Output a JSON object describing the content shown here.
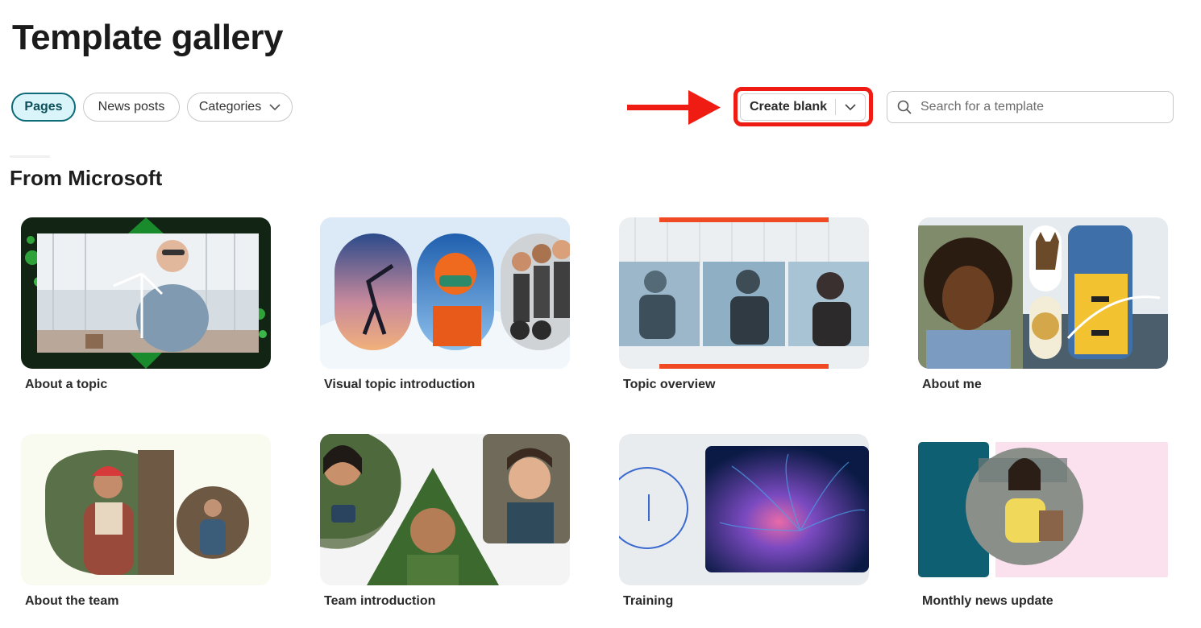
{
  "page": {
    "title": "Template gallery"
  },
  "filters": [
    {
      "label": "Pages",
      "active": true
    },
    {
      "label": "News posts",
      "active": false
    },
    {
      "label": "Categories",
      "active": false,
      "has_dropdown": true
    }
  ],
  "create_button": {
    "label": "Create blank"
  },
  "search": {
    "placeholder": "Search for a template",
    "icon": "search-icon"
  },
  "section": {
    "title": "From Microsoft"
  },
  "colors": {
    "accent": "#0e6b77",
    "highlight": "#ee1c13",
    "active_fill": "#d9f5fa"
  },
  "templates": [
    {
      "label": "About a topic"
    },
    {
      "label": "Visual topic introduction"
    },
    {
      "label": "Topic overview"
    },
    {
      "label": "About me"
    },
    {
      "label": "About the team"
    },
    {
      "label": "Team introduction"
    },
    {
      "label": "Training"
    },
    {
      "label": "Monthly news update"
    }
  ]
}
